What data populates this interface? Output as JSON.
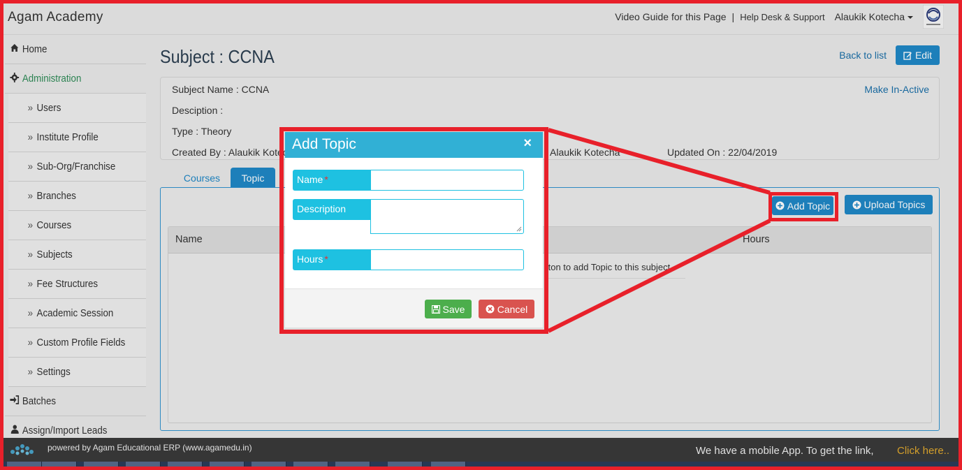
{
  "header": {
    "brand": "Agam Academy",
    "video_guide": "Video Guide for this Page",
    "separator": "|",
    "help_desk": "Help Desk & Support",
    "user": "Alaukik Kotecha"
  },
  "sidebar": {
    "items": [
      {
        "label": "Home",
        "icon": "home-icon",
        "level": "top"
      },
      {
        "label": "Administration",
        "icon": "gear-icon",
        "level": "top"
      },
      {
        "label": "Users",
        "level": "sub"
      },
      {
        "label": "Institute Profile",
        "level": "sub"
      },
      {
        "label": "Sub-Org/Franchise",
        "level": "sub"
      },
      {
        "label": "Branches",
        "level": "sub"
      },
      {
        "label": "Courses",
        "level": "sub"
      },
      {
        "label": "Subjects",
        "level": "sub"
      },
      {
        "label": "Fee Structures",
        "level": "sub"
      },
      {
        "label": "Academic Session",
        "level": "sub"
      },
      {
        "label": "Custom Profile Fields",
        "level": "sub"
      },
      {
        "label": "Settings",
        "level": "sub"
      },
      {
        "label": "Batches",
        "icon": "sign-in-icon",
        "level": "top"
      },
      {
        "label": "Assign/Import Leads",
        "icon": "user-icon",
        "level": "top"
      }
    ]
  },
  "main": {
    "title": "Subject : CCNA",
    "back_link": "Back to list",
    "edit_label": "Edit",
    "info": {
      "subject_name": "Subject Name : CCNA",
      "description": "Desciption :",
      "type": "Type : Theory",
      "created_by": "Created By : Alaukik Kotecha",
      "updated_by": "Alaukik Kotecha",
      "updated_on": "Updated On : 22/04/2019",
      "make_inactive": "Make In-Active"
    },
    "tabs": [
      {
        "label": "Courses",
        "active": false
      },
      {
        "label": "Topic",
        "active": true
      }
    ],
    "add_topic_label": "Add Topic",
    "upload_topics_label": "Upload Topics",
    "table": {
      "columns": [
        "Name",
        "Hours"
      ],
      "empty_message": "tton to add Topic to this subject"
    }
  },
  "modal": {
    "title": "Add Topic",
    "close": "×",
    "fields": {
      "name_label": "Name",
      "description_label": "Description",
      "hours_label": "Hours",
      "required_mark": "*"
    },
    "save_label": "Save",
    "cancel_label": "Cancel"
  },
  "footer": {
    "powered": "powered by Agam Educational ERP (www.agamedu.in)",
    "mobile_text": "We have a mobile App. To get the link,",
    "click_here": "Click here.."
  },
  "colors": {
    "primary": "#1f87c6",
    "modal_header": "#31b0d5",
    "label_bg": "#1ec1e1",
    "save": "#4cae4c",
    "cancel": "#d9534f",
    "annotation": "#e8202a",
    "admin_green": "#2e8b57",
    "footer_link": "#e0a82e"
  }
}
